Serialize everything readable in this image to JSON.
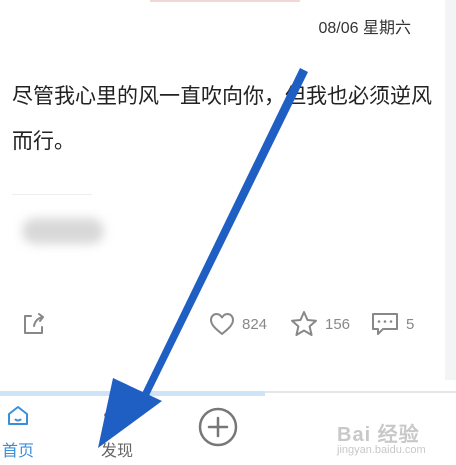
{
  "post": {
    "date": "08/06 星期六",
    "content": "尽管我心里的风一直吹向你，但我也必须逆风而行。"
  },
  "actions": {
    "like_count": "824",
    "star_count": "156",
    "comment_count": "5"
  },
  "tabbar": {
    "home_label": "首页",
    "discover_label": "发现"
  },
  "watermark": {
    "text": "Bai 经验",
    "sub": "jingyan.baidu.com"
  },
  "colors": {
    "accent": "#3b8fd9",
    "arrow": "#1f5fc4"
  }
}
